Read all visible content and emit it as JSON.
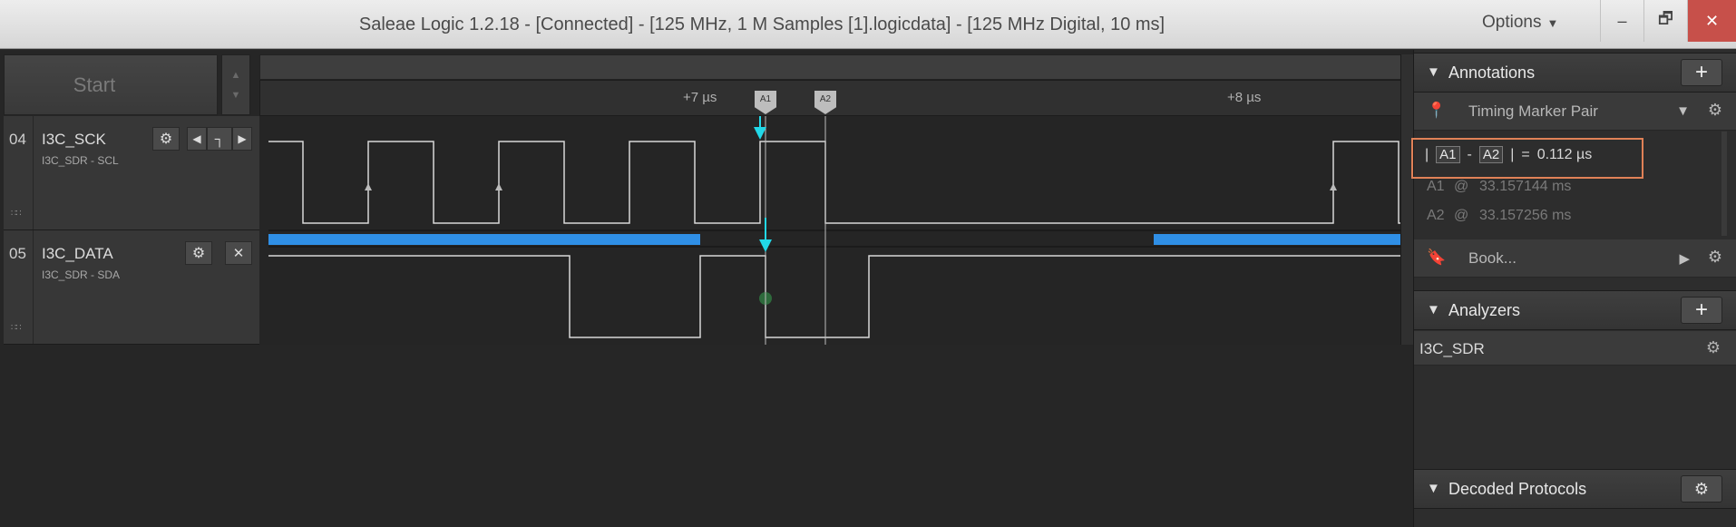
{
  "window": {
    "title": "Saleae Logic 1.2.18 - [Connected] - [125 MHz, 1 M Samples [1].logicdata] - [125 MHz Digital, 10 ms]",
    "options_label": "Options",
    "minimize": "–",
    "restore": "🗗",
    "close": "✕"
  },
  "capture": {
    "start_label": "Start"
  },
  "timeline": {
    "ticks": [
      {
        "label": "+7 µs"
      },
      {
        "label": "+8 µs"
      }
    ],
    "markers": [
      {
        "label": "A1"
      },
      {
        "label": "A2"
      }
    ]
  },
  "channels": [
    {
      "number": "04",
      "name": "I3C_SCK",
      "subtitle": "I3C_SDR - SCL",
      "color": "#f0a020"
    },
    {
      "number": "05",
      "name": "I3C_DATA",
      "subtitle": "I3C_SDR - SDA",
      "color": "#5cb83c"
    }
  ],
  "annotations": {
    "header": "Annotations",
    "add": "+",
    "timing_pair_label": "Timing Marker Pair",
    "measurement": {
      "left": "A1",
      "dash": "-",
      "right": "A2",
      "equals": "=",
      "value": "0.112 µs",
      "bar": "|"
    },
    "a1": {
      "name": "A1",
      "at": "@",
      "time": "33.157144 ms"
    },
    "a2": {
      "name": "A2",
      "at": "@",
      "time": "33.157256 ms"
    },
    "bookmark_label": "Book..."
  },
  "analyzers": {
    "header": "Analyzers",
    "add": "+",
    "items": [
      {
        "name": "I3C_SDR"
      }
    ]
  },
  "decoded": {
    "header": "Decoded Protocols"
  },
  "colors": {
    "accent_blue": "#2f8fe6",
    "marker_cyan": "#22d8e8",
    "highlight_orange": "#e08157"
  }
}
